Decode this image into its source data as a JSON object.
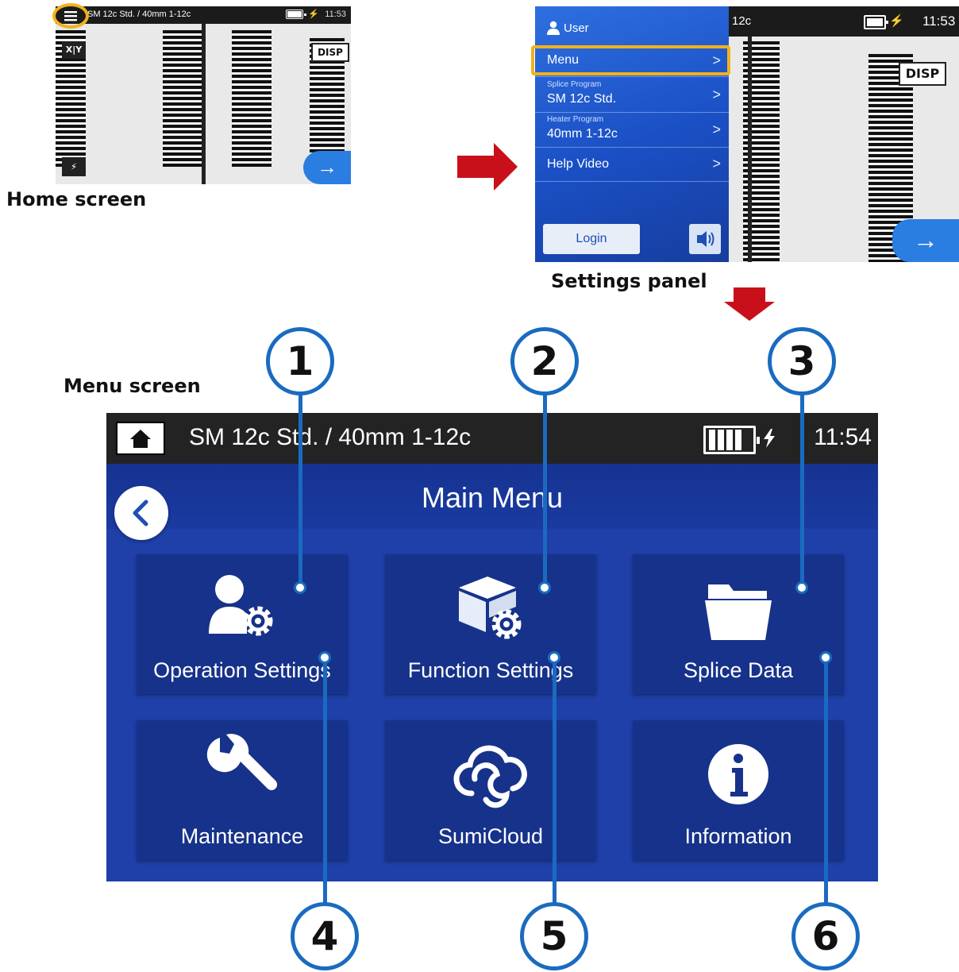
{
  "home_screen": {
    "caption": "Home screen",
    "topbar_title": "SM 12c Std. / 40mm 1-12c",
    "time": "11:53",
    "xy_button": "X|Y",
    "disp_button": "DISP"
  },
  "settings_panel": {
    "caption": "Settings panel",
    "topbar_title": "12c",
    "time": "11:53",
    "user_label": "User",
    "rows": [
      {
        "sub": "",
        "label": "Menu"
      },
      {
        "sub": "Splice Program",
        "label": "SM 12c Std."
      },
      {
        "sub": "Heater Program",
        "label": "40mm 1-12c"
      },
      {
        "sub": "",
        "label": "Help Video"
      }
    ],
    "login_button": "Login",
    "disp_button": "DISP"
  },
  "menu_screen": {
    "caption": "Menu screen",
    "topbar_title": "SM 12c Std. / 40mm 1-12c",
    "time": "11:54",
    "header_title": "Main Menu",
    "tiles": [
      {
        "label": "Operation Settings",
        "icon": "operator-gear-icon",
        "callout": "1"
      },
      {
        "label": "Function Settings",
        "icon": "box-gear-icon",
        "callout": "2"
      },
      {
        "label": "Splice Data",
        "icon": "folder-icon",
        "callout": "3"
      },
      {
        "label": "Maintenance",
        "icon": "wrench-icon",
        "callout": "4"
      },
      {
        "label": "SumiCloud",
        "icon": "cloud-icon",
        "callout": "5"
      },
      {
        "label": "Information",
        "icon": "info-icon",
        "callout": "6"
      }
    ]
  },
  "colors": {
    "highlight": "#f2b21a",
    "arrow": "#c8101a",
    "menu_blue": "#1e40a8",
    "callout_blue": "#1a6bc0"
  }
}
